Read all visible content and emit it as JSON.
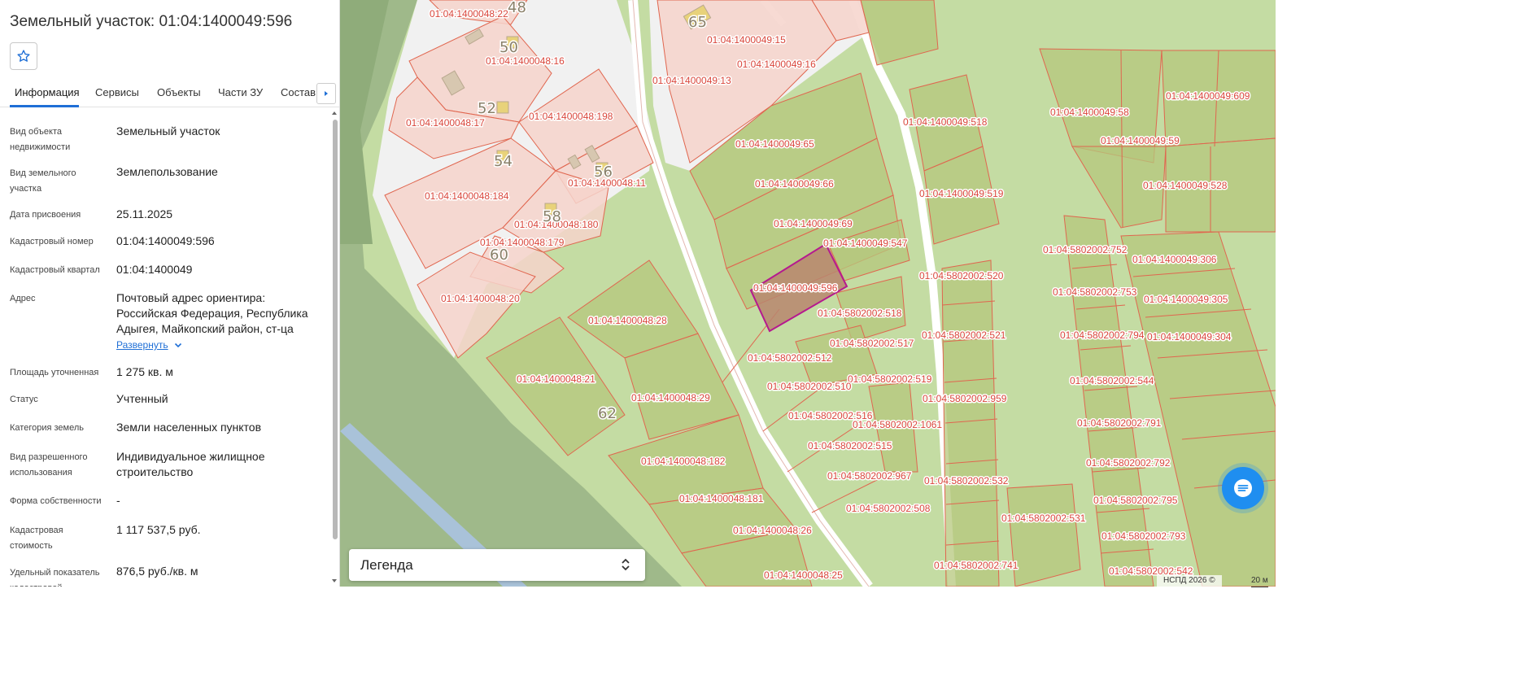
{
  "panel": {
    "title": "Земельный участок: 01:04:1400049:596",
    "favorite_icon": "star-outline-icon",
    "tabs": [
      "Информация",
      "Сервисы",
      "Объекты",
      "Части ЗУ",
      "Состав"
    ],
    "active_tab": 0,
    "rows": [
      {
        "label": "Вид объекта недвижимости",
        "value": "Земельный участок"
      },
      {
        "label": "Вид земельного участка",
        "value": "Землепользование"
      },
      {
        "label": "Дата присвоения",
        "value": "25.11.2025"
      },
      {
        "label": "Кадастровый номер",
        "value": "01:04:1400049:596"
      },
      {
        "label": "Кадастровый квартал",
        "value": "01:04:1400049"
      },
      {
        "label": "Адрес",
        "value": "Почтовый адрес ориентира: Российская Федерация, Республика Адыгея, Майкопский район, ст-ца"
      },
      {
        "label": "Площадь уточненная",
        "value": "1 275 кв. м"
      },
      {
        "label": "Статус",
        "value": "Учтенный"
      },
      {
        "label": "Категория земель",
        "value": "Земли населенных пунктов"
      },
      {
        "label": "Вид разрешенного использования",
        "value": "Индивидуальное жилищное строительство"
      },
      {
        "label": "Форма собственности",
        "value": "-"
      },
      {
        "label": "Кадастровая стоимость",
        "value": "1 117 537,5 руб."
      },
      {
        "label": "Удельный показатель кадастровой",
        "value": "876,5 руб./кв. м"
      }
    ],
    "expand_label": "Развернуть"
  },
  "map": {
    "legend_title": "Легенда",
    "copyright": "НСПД 2026 ©",
    "scale_label": "20 м",
    "selected_parcel": "01:04:1400049:596",
    "colors": {
      "parcel_border": "#e0664f",
      "parcel_fill": "#b9c97e",
      "settlement_fill": "#f7d8d2",
      "selected_border": "#b5198f",
      "selected_fill": "#b98a72",
      "road": "#f4f4f4",
      "water": "#9fb9d6",
      "chat_button": "#1f8ef0"
    },
    "parcel_labels": [
      "01:04:1400048:22",
      "01:04:1400048:16",
      "01:04:1400048:17",
      "01:04:1400048:198",
      "01:04:1400048:184",
      "01:04:1400048:11",
      "01:04:1400048:180",
      "01:04:1400048:179",
      "01:04:1400048:20",
      "01:04:1400048:28",
      "01:04:1400048:21",
      "01:04:1400048:29",
      "01:04:1400048:182",
      "01:04:1400048:181",
      "01:04:1400048:26",
      "01:04:1400048:25",
      "01:04:1400049:15",
      "01:04:1400049:16",
      "01:04:1400049:13",
      "01:04:1400049:65",
      "01:04:1400049:66",
      "01:04:1400049:69",
      "01:04:1400049:547",
      "01:04:1400049:596",
      "01:04:1400049:518",
      "01:04:1400049:519",
      "01:04:1400049:58",
      "01:04:1400049:609",
      "01:04:1400049:59",
      "01:04:1400049:528",
      "01:04:1400049:306",
      "01:04:1400049:305",
      "01:04:1400049:304",
      "01:04:5802002:752",
      "01:04:5802002:753",
      "01:04:5802002:794",
      "01:04:5802002:544",
      "01:04:5802002:791",
      "01:04:5802002:792",
      "01:04:5802002:795",
      "01:04:5802002:793",
      "01:04:5802002:542",
      "01:04:5802002:520",
      "01:04:5802002:518",
      "01:04:5802002:521",
      "01:04:5802002:517",
      "01:04:5802002:512",
      "01:04:5802002:519",
      "01:04:5802002:510",
      "01:04:5802002:959",
      "01:04:5802002:516",
      "01:04:5802002:1061",
      "01:04:5802002:515",
      "01:04:5802002:967",
      "01:04:5802002:532",
      "01:04:5802002:508",
      "01:04:5802002:531",
      "01:04:5802002:741"
    ],
    "house_numbers": [
      "48",
      "50",
      "52",
      "54",
      "56",
      "58",
      "60",
      "62",
      "65"
    ]
  }
}
